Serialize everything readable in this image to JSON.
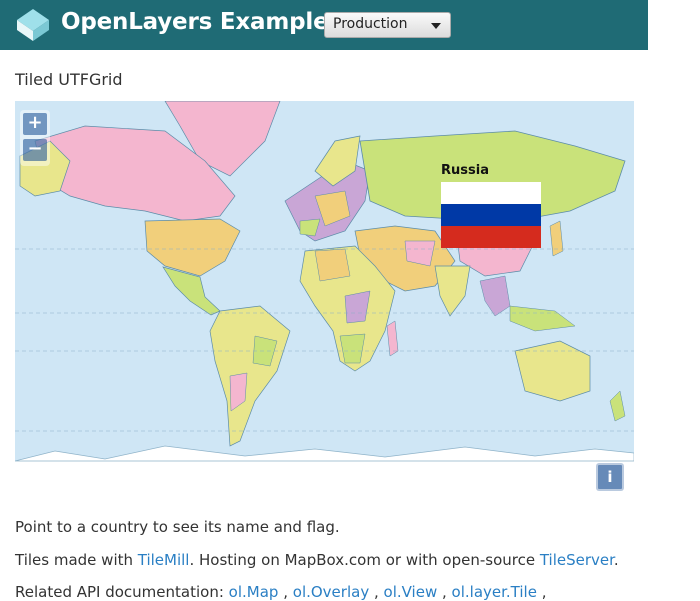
{
  "header": {
    "brand": "OpenLayers Examples",
    "version_select": "Production"
  },
  "page": {
    "title": "Tiled UTFGrid"
  },
  "map": {
    "zoom_in": "+",
    "zoom_out": "−",
    "attribution_button": "i",
    "hover": {
      "country": "Russia",
      "flag_colors": [
        "#ffffff",
        "#0039a6",
        "#d52b1e"
      ]
    },
    "colors": {
      "ocean": "#cfe6f5",
      "land_yellow": "#e8e68c",
      "land_pink": "#f4b6cf",
      "land_green": "#c9e27a",
      "land_orange": "#f1cf7b",
      "land_purple": "#c9a6d6",
      "ice": "#ffffff"
    }
  },
  "text": {
    "instruction": "Point to a country to see its name and flag.",
    "tiles_prefix": "Tiles made with ",
    "tilemill": "TileMill",
    "tiles_middle": ". Hosting on MapBox.com or with open-source ",
    "tileserver": "TileServer",
    "tiles_suffix": ".",
    "api_prefix": "Related API documentation: ",
    "api_links": [
      "ol.Map",
      "ol.Overlay",
      "ol.View",
      "ol.layer.Tile"
    ]
  }
}
